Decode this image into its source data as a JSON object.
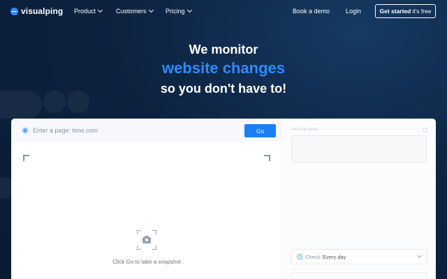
{
  "nav": {
    "logo": "visualping",
    "items": [
      {
        "label": "Product"
      },
      {
        "label": "Customers"
      },
      {
        "label": "Pricing"
      }
    ],
    "book_demo": "Book a demo",
    "login": "Login",
    "cta_main": "Get started",
    "cta_free": "it's free"
  },
  "hero": {
    "line1": "We monitor",
    "line2": "website changes",
    "line3": "so you don't have to!"
  },
  "monitor": {
    "url_placeholder": "Enter a page: time.com",
    "go_label": "Go",
    "snapshot_text": "Click Go to take a snapshot",
    "alert_label": "Alert me when:",
    "check_label": "Check:",
    "check_value": "Every day"
  },
  "colors": {
    "accent": "#2b8cff",
    "background": "#0d2341",
    "button": "#1a7ef7"
  }
}
